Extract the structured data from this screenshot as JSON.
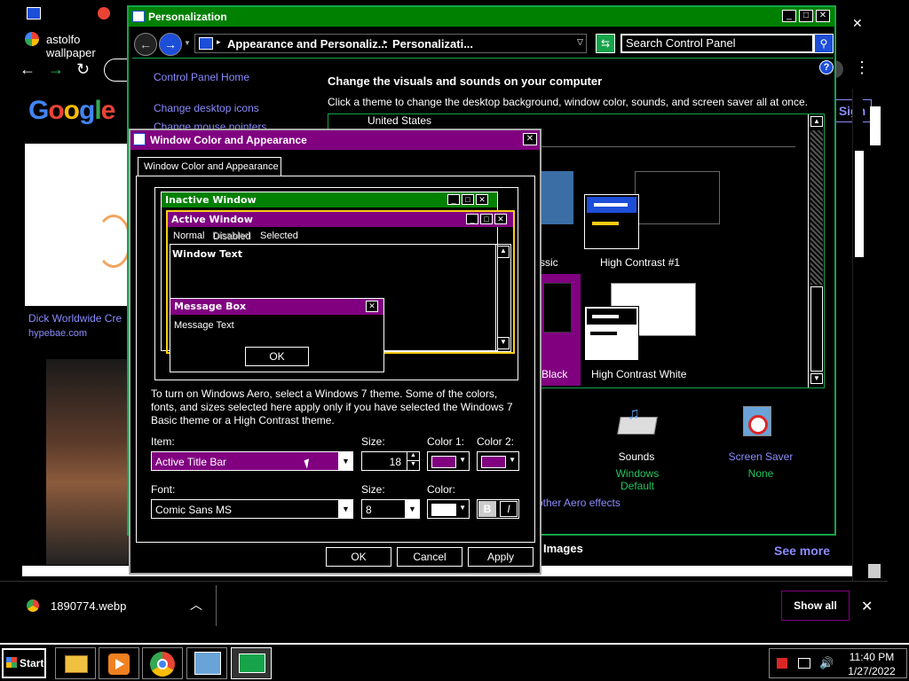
{
  "chrome": {
    "tab_title": "astolfo wallpaper",
    "google_letters": [
      "G",
      "o",
      "o",
      "g",
      "l",
      "e"
    ],
    "sign_in": "Sign",
    "result_title": "Dick Worldwide Cre",
    "result_source": "hypebae.com",
    "images_label": "Images",
    "see_more": "See more",
    "close_x": "✕"
  },
  "personalization": {
    "title": "Personalization",
    "breadcrumb_1": "Appearance and Personaliz...",
    "breadcrumb_2": "Personalizati...",
    "search_placeholder": "Search Control Panel",
    "sidebar": [
      "Control Panel Home",
      "Change desktop icons",
      "Change mouse pointers"
    ],
    "heading": "Change the visuals and sounds on your computer",
    "subheading": "Click a theme to change the desktop background, window color, sounds, and screen saver all at once.",
    "theme_group": "United States",
    "themes": [
      "ssic",
      "High Contrast #1",
      "Black",
      "High Contrast White"
    ],
    "sounds_label": "Sounds",
    "sounds_value": "Windows Default",
    "screensaver_label": "Screen Saver",
    "screensaver_value": "None",
    "aero_link": "other Aero effects",
    "help": "?"
  },
  "wca": {
    "title": "Window Color and Appearance",
    "tab": "Window Color and Appearance",
    "inactive_window": "Inactive Window",
    "active_window": "Active Window",
    "menu_normal": "Normal",
    "menu_disabled": "Disabled",
    "menu_selected": "Selected",
    "window_text": "Window Text",
    "message_box": "Message Box",
    "message_text": "Message Text",
    "msg_ok": "OK",
    "info": "To turn on Windows Aero, select a Windows 7 theme.  Some of the colors, fonts, and sizes selected here apply only if you have selected the Windows 7 Basic theme or a High Contrast theme.",
    "item_label": "Item:",
    "item_value": "Active Title Bar",
    "size_label": "Size:",
    "size_value": "18",
    "color1_label": "Color 1:",
    "color2_label": "Color 2:",
    "font_label": "Font:",
    "font_value": "Comic Sans MS",
    "font_size_label": "Size:",
    "font_size_value": "8",
    "color_label": "Color:",
    "bold": "B",
    "italic": "I",
    "ok": "OK",
    "cancel": "Cancel",
    "apply": "Apply",
    "colors": {
      "title_active": "#800080",
      "title_inactive": "#008000",
      "color1": "#800080",
      "color2": "#800080",
      "font_color": "#ffffff"
    }
  },
  "downloads": {
    "file": "1890774.webp",
    "show_all": "Show all"
  },
  "taskbar": {
    "start": "Start",
    "time": "11:40 PM",
    "date": "1/27/2022"
  }
}
